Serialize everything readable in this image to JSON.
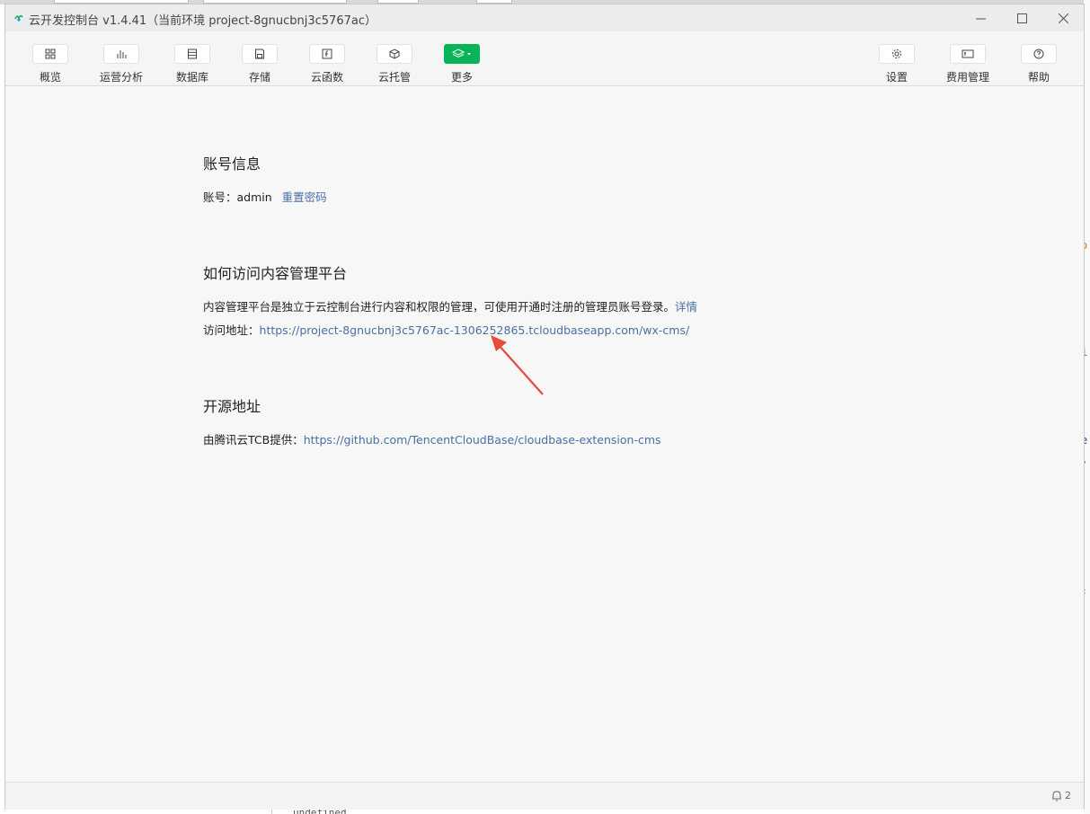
{
  "window": {
    "title": "云开发控制台 v1.4.41（当前环境 project-8gnucbnj3c5767ac）",
    "controls": [
      "minimize",
      "maximize",
      "close"
    ]
  },
  "toolbar": {
    "left": [
      {
        "label": "概览",
        "icon": "grid-icon"
      },
      {
        "label": "运营分析",
        "icon": "bar-chart-icon"
      },
      {
        "label": "数据库",
        "icon": "database-icon"
      },
      {
        "label": "存储",
        "icon": "storage-icon"
      },
      {
        "label": "云函数",
        "icon": "function-icon"
      },
      {
        "label": "云托管",
        "icon": "cube-icon"
      },
      {
        "label": "更多",
        "icon": "layers-icon"
      }
    ],
    "right": [
      {
        "label": "设置",
        "icon": "gear-icon"
      },
      {
        "label": "费用管理",
        "icon": "wallet-icon"
      },
      {
        "label": "帮助",
        "icon": "help-icon"
      }
    ]
  },
  "account": {
    "title": "账号信息",
    "label": "账号：",
    "value": "admin",
    "reset_link": "重置密码"
  },
  "access": {
    "title": "如何访问内容管理平台",
    "description": "内容管理平台是独立于云控制台进行内容和权限的管理，可使用开通时注册的管理员账号登录。",
    "details_link": "详情",
    "url_label": "访问地址：",
    "url": "https://project-8gnucbnj3c5767ac-1306252865.tcloudbaseapp.com/wx-cms/"
  },
  "opensource": {
    "title": "开源地址",
    "label": "由腾讯云TCB提供：",
    "url": "https://github.com/TencentCloudBase/cloudbase-extension-cms"
  },
  "statusbar": {
    "notification_count": "2"
  },
  "colors": {
    "accent_green": "#09b459",
    "link": "#4a6fa5",
    "annotation_arrow": "#e84a3c"
  },
  "background": {
    "bottom_text": "undefined"
  }
}
